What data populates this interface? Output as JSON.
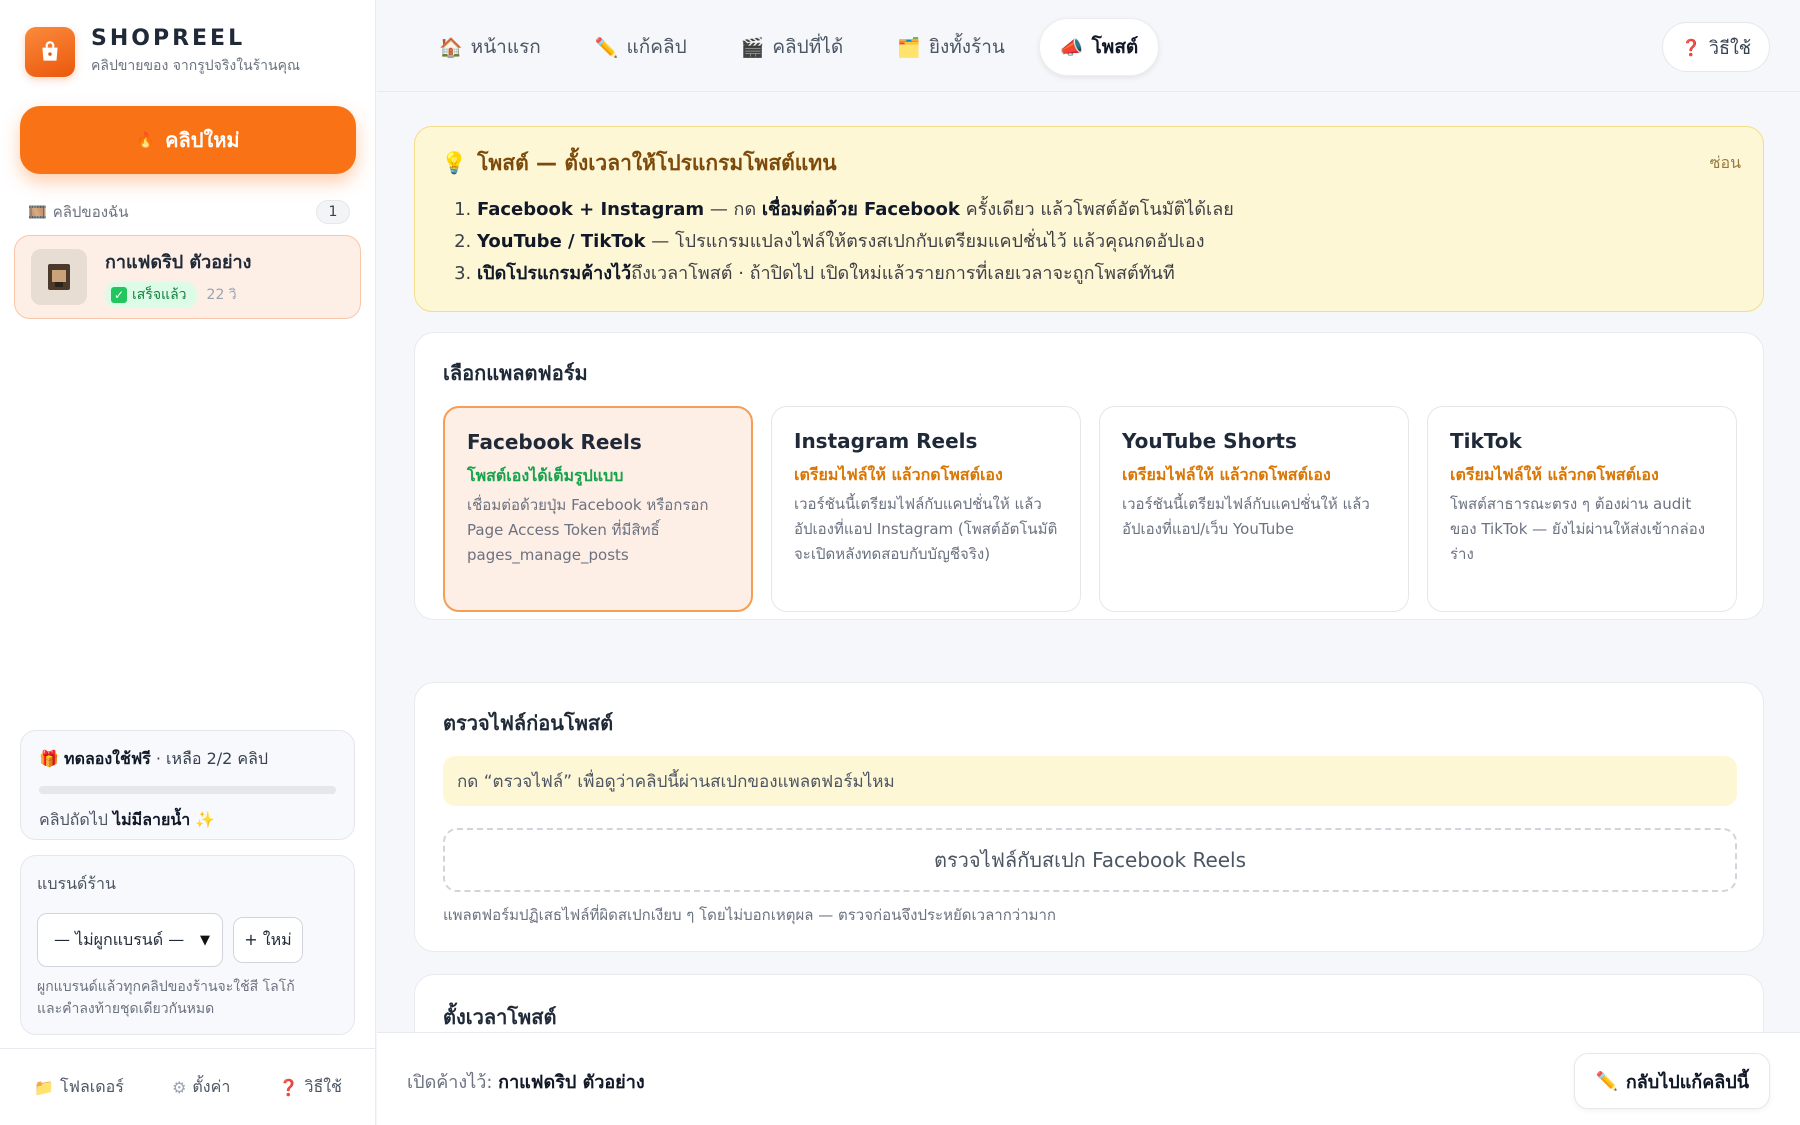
{
  "app": {
    "name": "SHOPREEL",
    "subtitle": "คลิปขายของ จากรูปจริงในร้านคุณ"
  },
  "sidebar": {
    "new_clip_label": "คลิปใหม่",
    "my_clips_label": "คลิปของฉัน",
    "my_clips_count": "1",
    "clips": [
      {
        "title": "กาแฟดริป ตัวอย่าง",
        "status": "เสร็จแล้ว",
        "duration": "22 วิ"
      }
    ],
    "trial": {
      "label": "ทดลองใช้ฟรี",
      "remaining": "· เหลือ 2/2 คลิป",
      "progress_fraction": 0,
      "next_prefix": "คลิปถัดไป",
      "next_bold": "ไม่มีลายน้ำ",
      "next_icon": "✨"
    },
    "brand": {
      "title": "แบรนด์ร้าน",
      "select_value": "— ไม่ผูกแบรนด์ —",
      "new_label": "+ ใหม่",
      "help_line1": "ผูกแบรนด์แล้วทุกคลิปของร้านจะใช้สี โลโก้",
      "help_line2": "และคำลงท้ายชุดเดียวกันหมด"
    },
    "footer": [
      {
        "icon": "📁",
        "label": "โฟลเดอร์"
      },
      {
        "icon": "⚙",
        "label": "ตั้งค่า"
      },
      {
        "icon": "❓",
        "label": "วิธีใช้"
      }
    ]
  },
  "topbar": {
    "tabs": [
      {
        "icon": "🏠",
        "label": "หน้าแรก",
        "active": false
      },
      {
        "icon": "✏️",
        "label": "แก้คลิป",
        "active": false
      },
      {
        "icon": "🎬",
        "label": "คลิปที่ได้",
        "active": false
      },
      {
        "icon": "🗂️",
        "label": "ยิงทั้งร้าน",
        "active": false
      },
      {
        "icon": "📣",
        "label": "โพสต์",
        "active": true
      }
    ],
    "help_label": "วิธีใช้",
    "help_icon": "❓"
  },
  "info": {
    "icon": "💡",
    "title": "โพสต์ — ตั้งเวลาให้โปรแกรมโพสต์แทน",
    "hide_label": "ซ่อน",
    "items": [
      {
        "bold": "Facebook + Instagram",
        "mid": " — กด ",
        "bold2": "เชื่อมต่อด้วย Facebook",
        "rest": " ครั้งเดียว แล้วโพสต์อัตโนมัติได้เลย"
      },
      {
        "bold": "YouTube / TikTok",
        "mid": " — โปรแกรมแปลงไฟล์ให้ตรงสเปกกับเตรียมแคปชั่นไว้ แล้วคุณกดอัปเอง",
        "bold2": "",
        "rest": ""
      },
      {
        "bold": "เปิดโปรแกรมค้างไว้",
        "mid": "ถึงเวลาโพสต์ · ถ้าปิดไป เปิดใหม่แล้วรายการที่เลยเวลาจะถูกโพสต์ทันที",
        "bold2": "",
        "rest": ""
      }
    ]
  },
  "platform_section": {
    "title": "เลือกแพลตฟอร์ม",
    "platforms": [
      {
        "name": "Facebook Reels",
        "tag": "โพสต์เองได้เต็มรูปแบบ",
        "tag_color": "#16a34a",
        "desc": "เชื่อมต่อด้วยปุ่ม Facebook หรือกรอก Page Access Token ที่มีสิทธิ์ pages_manage_posts",
        "selected": true
      },
      {
        "name": "Instagram Reels",
        "tag": "เตรียมไฟล์ให้ แล้วกดโพสต์เอง",
        "tag_color": "#d97706",
        "desc": "เวอร์ชันนี้เตรียมไฟล์กับแคปชั่นให้ แล้วอัปเองที่แอป Instagram (โพสต์อัตโนมัติจะเปิดหลังทดสอบกับบัญชีจริง)",
        "selected": false
      },
      {
        "name": "YouTube Shorts",
        "tag": "เตรียมไฟล์ให้ แล้วกดโพสต์เอง",
        "tag_color": "#d97706",
        "desc": "เวอร์ชันนี้เตรียมไฟล์กับแคปชั่นให้ แล้วอัปเองที่แอป/เว็บ YouTube",
        "selected": false
      },
      {
        "name": "TikTok",
        "tag": "เตรียมไฟล์ให้ แล้วกดโพสต์เอง",
        "tag_color": "#d97706",
        "desc": "โพสต์สาธารณะตรง ๆ ต้องผ่าน audit ของ TikTok — ยังไม่ผ่านให้ส่งเข้ากล่องร่าง",
        "selected": false
      }
    ]
  },
  "check_section": {
    "title": "ตรวจไฟล์ก่อนโพสต์",
    "hint": "กด “ตรวจไฟล์” เพื่อดูว่าคลิปนี้ผ่านสเปกของแพลตฟอร์มไหม",
    "button_label": "ตรวจไฟล์กับสเปก Facebook Reels",
    "note": "แพลตฟอร์มปฏิเสธไฟล์ที่ผิดสเปกเงียบ ๆ โดยไม่บอกเหตุผล — ตรวจก่อนจึงประหยัดเวลากว่ามาก"
  },
  "schedule_section": {
    "title": "ตั้งเวลาโพสต์"
  },
  "bottombar": {
    "open_prefix": "เปิดค้างไว้:",
    "open_clip": "กาแฟดริป ตัวอย่าง",
    "back_label": "กลับไปแก้คลิปนี้",
    "back_icon": "✏️"
  }
}
